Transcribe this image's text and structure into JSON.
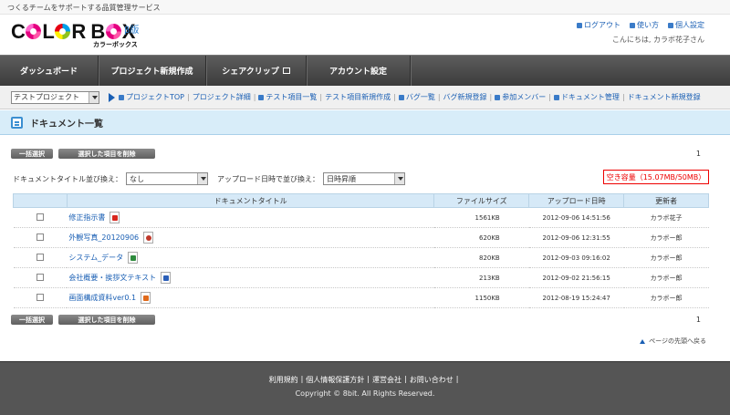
{
  "topbar": {
    "tagline": "つくるチームをサポートする品質管理サービス"
  },
  "header": {
    "logo_text_1": "C",
    "logo_text_2": "L",
    "logo_text_3": "R B",
    "logo_text_4": "X",
    "logo_beta": "β版",
    "logo_kana": "カラーボックス",
    "links": [
      {
        "label": "ログアウト"
      },
      {
        "label": "使い方"
      },
      {
        "label": "個人設定"
      }
    ],
    "greeting": "こんにちは, カラボ花子さん"
  },
  "nav": {
    "items": [
      {
        "label": "ダッシュボード"
      },
      {
        "label": "プロジェクト新規作成"
      },
      {
        "label": "シェアクリップ"
      },
      {
        "label": "アカウント設定"
      }
    ]
  },
  "subnav": {
    "project_select": "テストプロジェクト",
    "links": [
      {
        "label": "プロジェクトTOP"
      },
      {
        "label": "プロジェクト詳細"
      },
      {
        "label": "テスト項目一覧"
      },
      {
        "label": "テスト項目新規作成"
      },
      {
        "label": "バグ一覧"
      },
      {
        "label": "バグ新規登録"
      },
      {
        "label": "参加メンバー"
      },
      {
        "label": "ドキュメント管理"
      },
      {
        "label": "ドキュメント新規登録"
      }
    ]
  },
  "page": {
    "title": "ドキュメント一覧"
  },
  "actions": {
    "select_all": "一括選択",
    "delete_selected": "選択した項目を削除",
    "page_number": "1"
  },
  "filters": {
    "title_sort_label": "ドキュメントタイトル並び換え：",
    "title_sort_value": "なし",
    "date_sort_label": "アップロード日時で並び換え：",
    "date_sort_value": "日時昇順"
  },
  "capacity": "空き容量（15.07MB/50MB）",
  "table": {
    "headers": [
      "ドキュメントタイトル",
      "ファイルサイズ",
      "アップロード日時",
      "更新者"
    ],
    "rows": [
      {
        "title": "修正指示書",
        "filetype": "pdf-icon",
        "size": "1561KB",
        "date": "2012-09-06 14:51:56",
        "user": "カラボ花子"
      },
      {
        "title": "外観写真_20120906",
        "filetype": "image-file-icon",
        "size": "620KB",
        "date": "2012-09-06 12:31:55",
        "user": "カラボー郎"
      },
      {
        "title": "システム_データ",
        "filetype": "excel-icon",
        "size": "820KB",
        "date": "2012-09-03 09:16:02",
        "user": "カラボー郎"
      },
      {
        "title": "会社概要・挨拶文テキスト",
        "filetype": "word-icon",
        "size": "213KB",
        "date": "2012-09-02 21:56:15",
        "user": "カラボー郎"
      },
      {
        "title": "画面構成資料ver0.1",
        "filetype": "powerpoint-icon",
        "size": "1150KB",
        "date": "2012-08-19 15:24:47",
        "user": "カラボー郎"
      }
    ]
  },
  "back_to_top": "ページの先頭へ戻る",
  "footer": {
    "links": [
      {
        "label": "利用規約"
      },
      {
        "label": "個人情報保護方針"
      },
      {
        "label": "運営会社"
      },
      {
        "label": "お問い合わせ"
      }
    ],
    "copyright": "Copyright © 8bit. All Rights Reserved."
  }
}
